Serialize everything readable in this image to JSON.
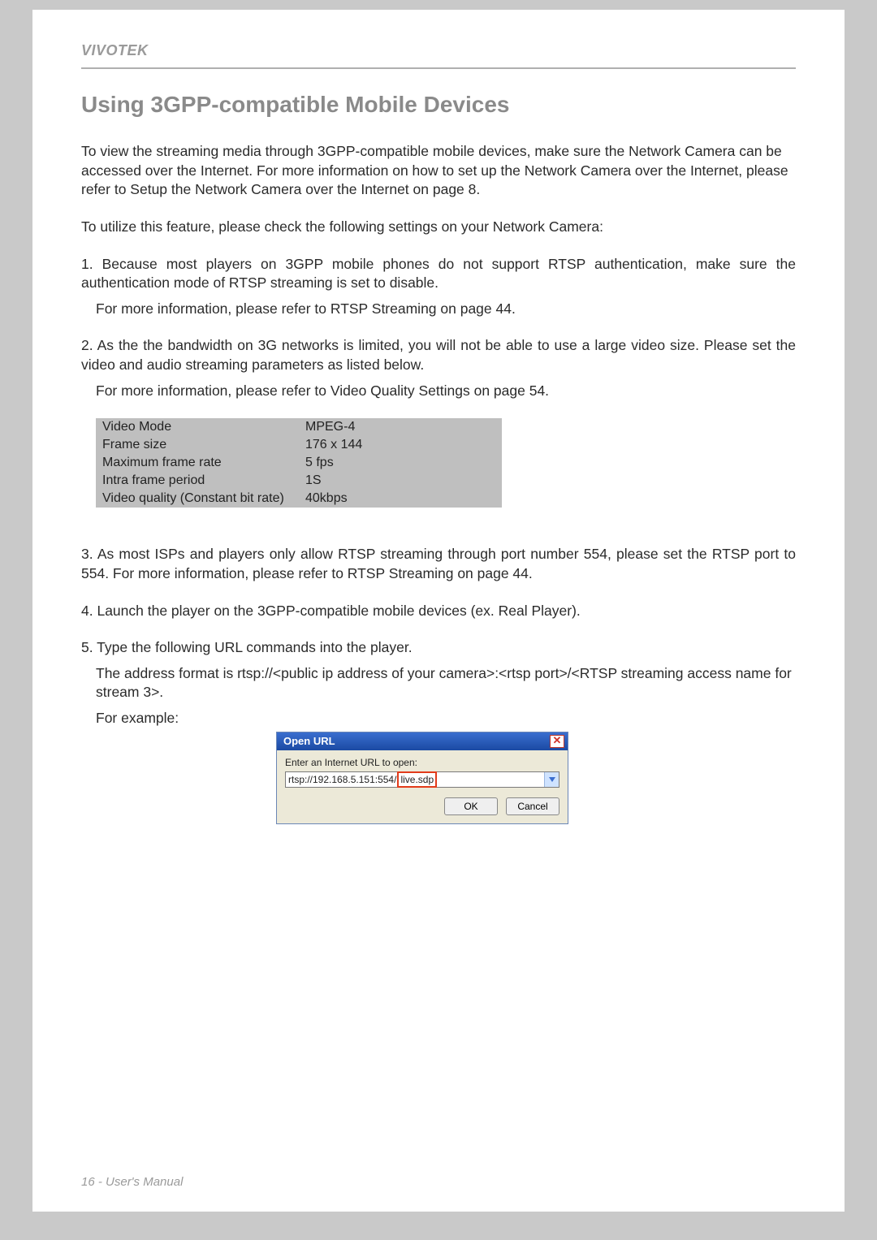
{
  "header": {
    "brand": "VIVOTEK"
  },
  "title": "Using 3GPP-compatible Mobile Devices",
  "p_intro": "To view the streaming media through 3GPP-compatible mobile devices, make sure the Network Camera can be accessed over the Internet. For more information on how to set up the Network Camera over the Internet, please refer to Setup the Network Camera over the Internet on page 8.",
  "p_utilize": "To utilize this feature, please check the following settings on your Network Camera:",
  "step1_a": "1. Because most players on 3GPP mobile phones do not support RTSP authentication, make sure the authentication mode of RTSP streaming is set to disable.",
  "step1_b": "For more information, please refer to RTSP Streaming on page 44.",
  "step2_a": "2. As the the bandwidth on 3G networks is limited, you will not be able to use a large video size. Please set the video and audio streaming parameters as listed below.",
  "step2_b": "For more information, please refer to Video Quality Settings on page 54.",
  "settings": [
    {
      "key": "Video Mode",
      "val": "MPEG-4"
    },
    {
      "key": "Frame size",
      "val": "176 x 144"
    },
    {
      "key": "Maximum frame rate",
      "val": "5 fps"
    },
    {
      "key": "Intra frame period",
      "val": "1S"
    },
    {
      "key": "Video quality (Constant bit rate)",
      "val": "40kbps"
    }
  ],
  "step3": "3. As most ISPs and players only allow RTSP streaming through port number 554, please set the RTSP port to 554. For more information, please refer to RTSP Streaming on page 44.",
  "step4": "4. Launch the player on the 3GPP-compatible mobile devices (ex. Real Player).",
  "step5_a": "5. Type the following URL commands into the player.",
  "step5_b": "The address format is rtsp://<public ip address of your camera>:<rtsp port>/<RTSP streaming access name for stream 3>.",
  "step5_c": "For example:",
  "dialog": {
    "title": "Open URL",
    "label": "Enter an Internet URL to open:",
    "url_prefix": "rtsp://192.168.5.151:554/",
    "url_highlight": "live.sdp",
    "ok": "OK",
    "cancel": "Cancel"
  },
  "footer": "16 - User's Manual"
}
